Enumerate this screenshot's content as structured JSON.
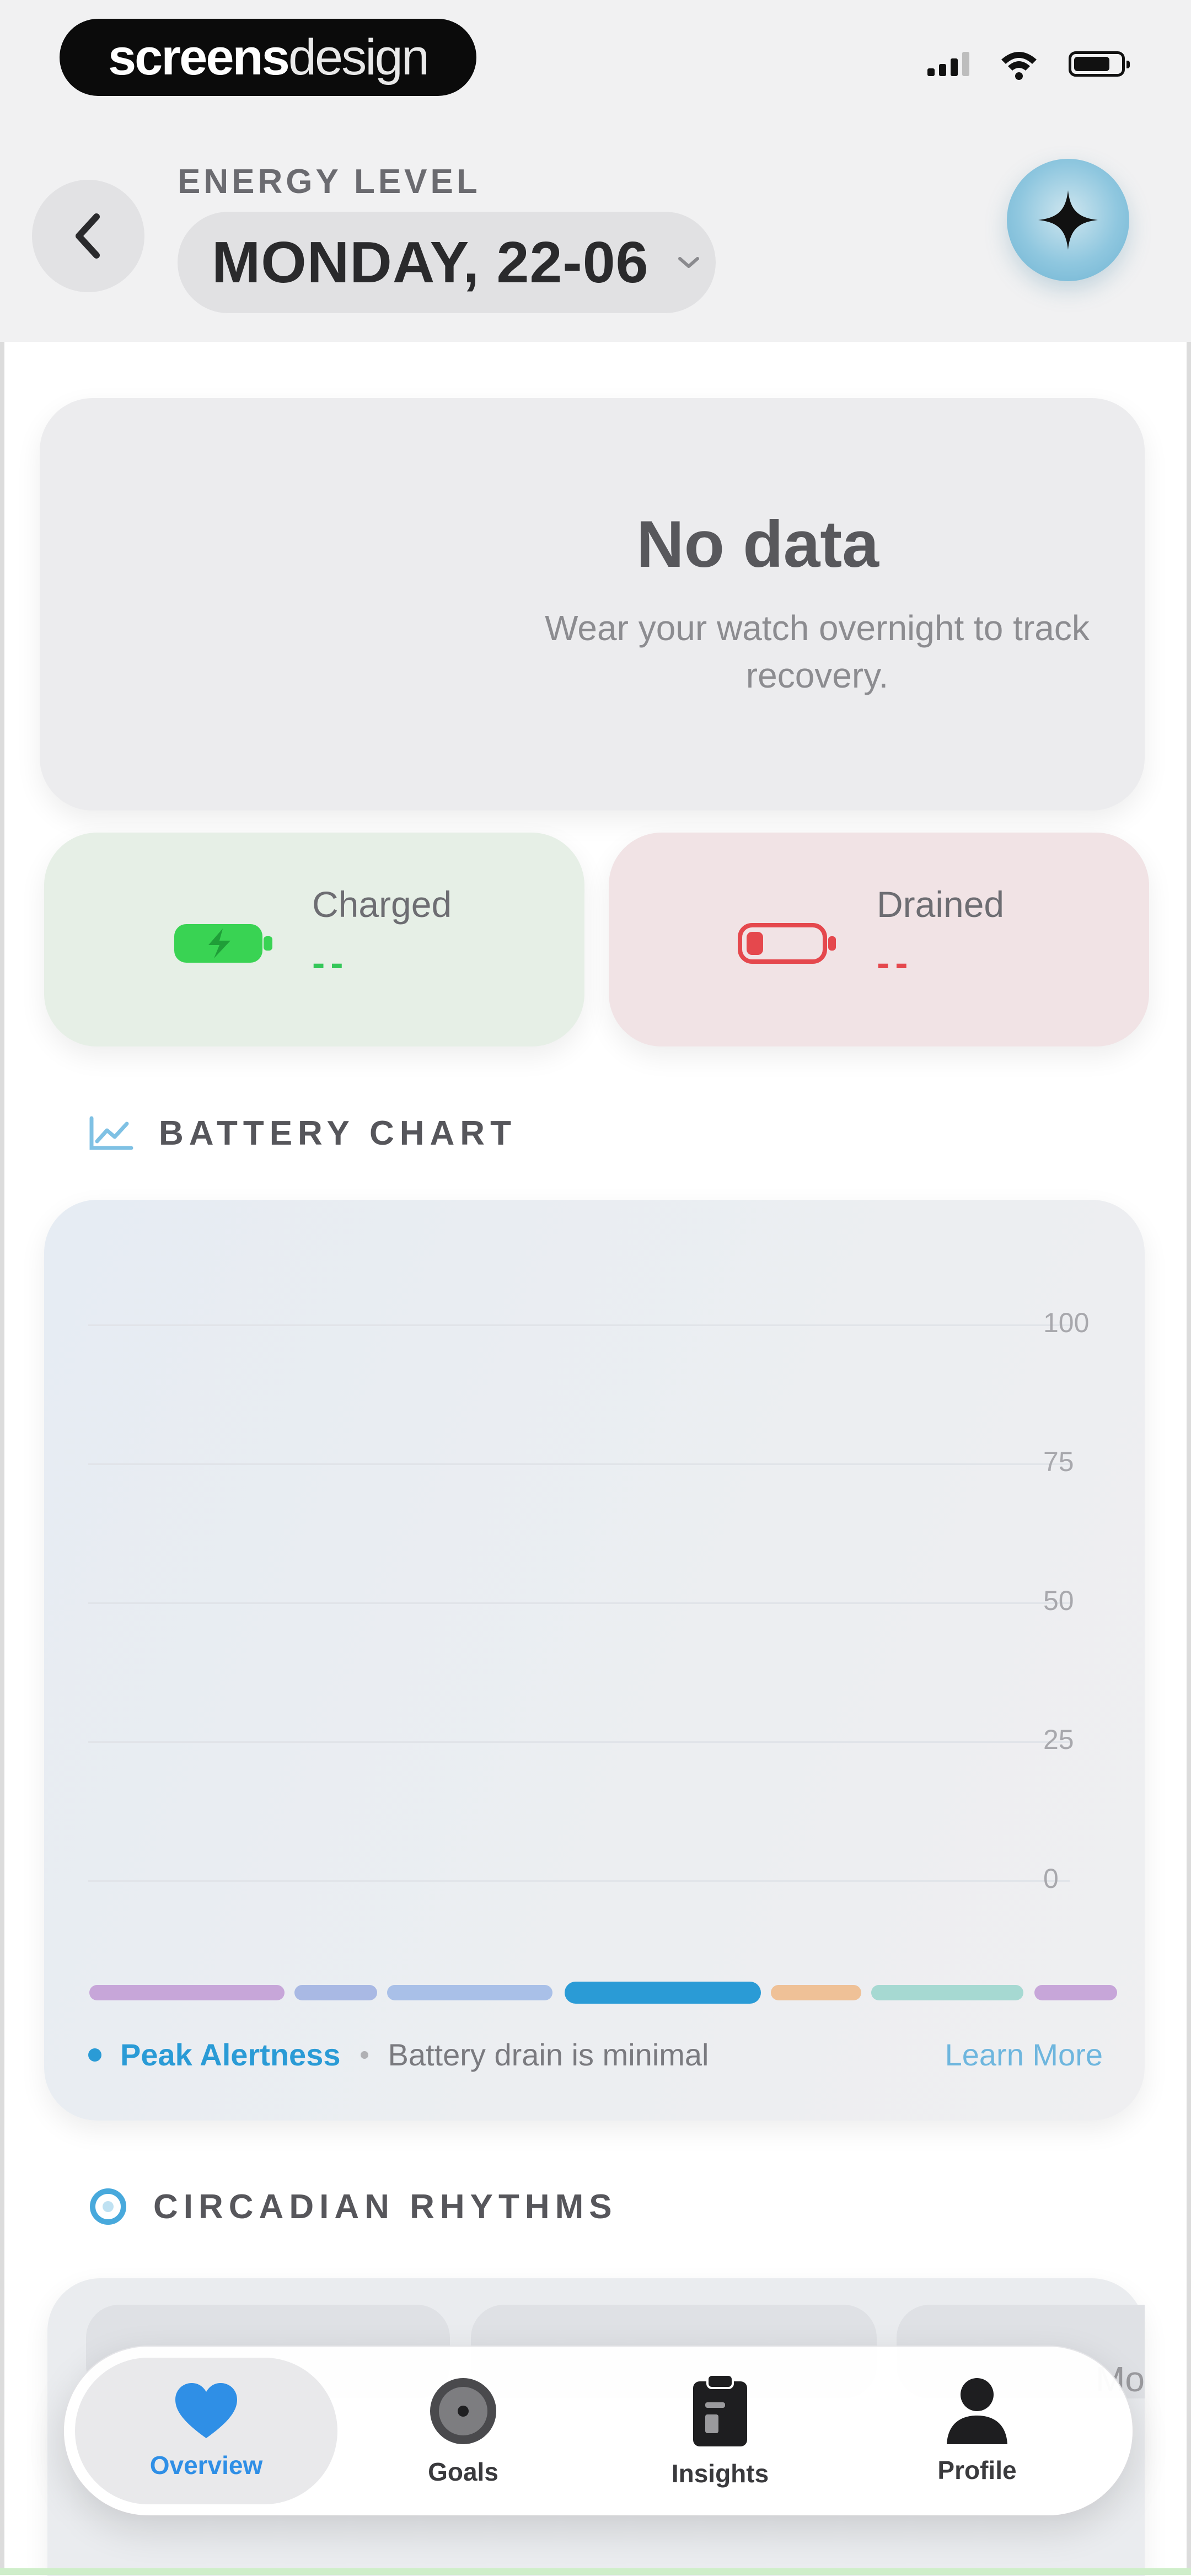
{
  "status_bar": {
    "brand_bold": "screens",
    "brand_light": "design"
  },
  "header": {
    "eyebrow": "ENERGY LEVEL",
    "date": "MONDAY, 22-06"
  },
  "summary": {
    "title": "No data",
    "subtitle": "Wear your watch overnight to track recovery."
  },
  "charged": {
    "label": "Charged",
    "value": "--",
    "icon": "battery-charging-icon",
    "color": "#34c759"
  },
  "drained": {
    "label": "Drained",
    "value": "--",
    "icon": "battery-low-icon",
    "color": "#e5484d"
  },
  "battery_chart": {
    "heading": "BATTERY CHART",
    "y_ticks": [
      "100",
      "75",
      "50",
      "25",
      "0"
    ],
    "legend": {
      "phase": "Peak Alertness",
      "description": "Battery drain is minimal",
      "link": "Learn More"
    }
  },
  "circadian": {
    "heading": "CIRCADIAN RHYTHMS",
    "partial_text": "Mo"
  },
  "tabs": [
    {
      "label": "Overview",
      "icon": "heart-icon"
    },
    {
      "label": "Goals",
      "icon": "target-icon"
    },
    {
      "label": "Insights",
      "icon": "clipboard-icon"
    },
    {
      "label": "Profile",
      "icon": "person-icon"
    }
  ],
  "colors": {
    "accent": "#2f8fe6",
    "peak_alertness": "#2a9bd6",
    "charged": "#34c759",
    "drained": "#e5484d"
  }
}
